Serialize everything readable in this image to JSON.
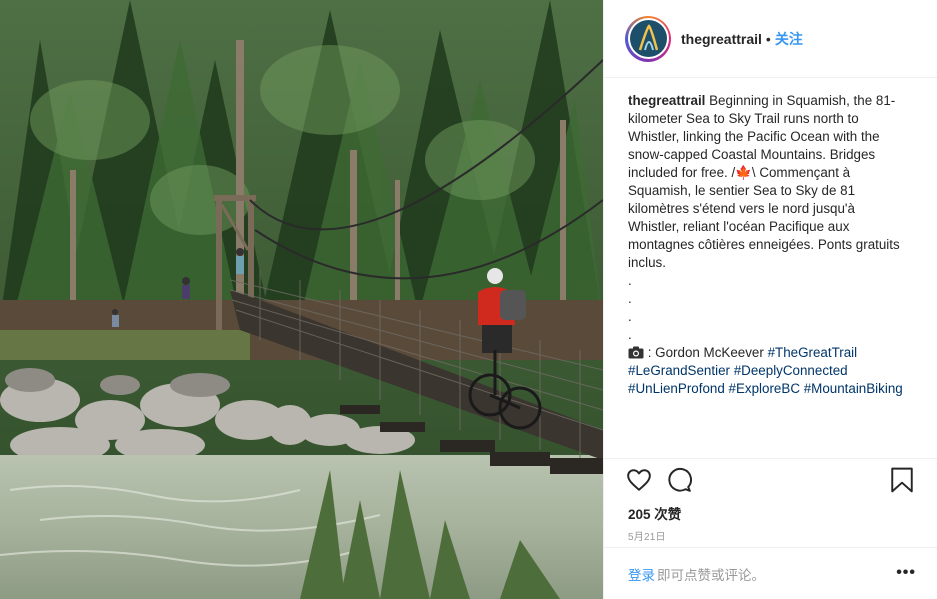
{
  "post": {
    "image_alt": "Cyclist crossing a suspension bridge over a river in a forest",
    "header": {
      "username": "thegreattrail",
      "separator": "•",
      "follow_label": "关注"
    },
    "caption": {
      "username": "thegreattrail",
      "lines": [
        "Beginning in Squamish, the 81-",
        "kilometer Sea to Sky Trail runs north to",
        "Whistler, linking the Pacific Ocean with the",
        "snow-capped Coastal Mountains. Bridges",
        "included for free. /",
        "\\ Commençant à",
        "Squamish, le sentier Sea to Sky de 81",
        "kilomètres s'étend vers le nord jusqu'à",
        "Whistler, reliant l'océan Pacifique aux",
        "montagnes côtières enneigées. Ponts gratuits",
        "inclus.",
        ".",
        ".",
        ".",
        "."
      ],
      "maple_emoji": "🍁",
      "credit_prefix": ": Gordon McKeever",
      "hashtags": [
        "#TheGreatTrail",
        "#LeGrandSentier",
        "#DeeplyConnected",
        "#UnLienProfond",
        "#ExploreBC",
        "#MountainBiking"
      ]
    },
    "likes_text": "205 次赞",
    "date_text": "5月21日",
    "comment": {
      "login_label": "登录",
      "hint": "即可点赞或评论。",
      "more_label": "•••"
    },
    "icons": [
      "heart-icon",
      "comment-icon",
      "bookmark-icon",
      "camera-icon",
      "more-options-icon"
    ],
    "colors": {
      "link_blue": "#3897f0",
      "hashtag_blue": "#003569",
      "text": "#262626",
      "muted": "#999999",
      "divider": "#efefef"
    }
  }
}
